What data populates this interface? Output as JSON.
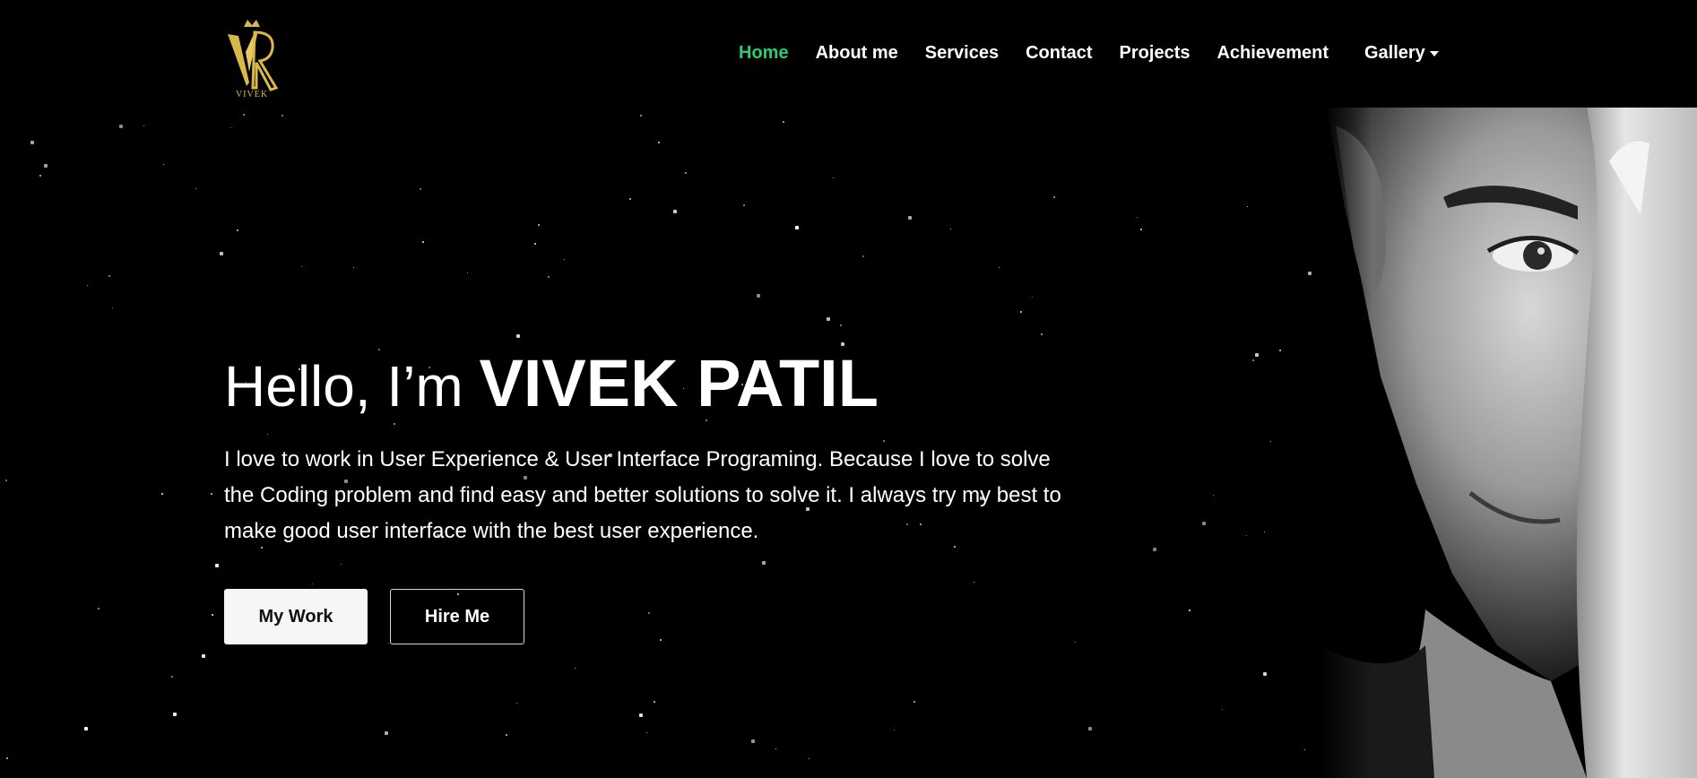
{
  "brand": {
    "logo_text": "VIVEK",
    "accent_color": "#d9b84a"
  },
  "nav": {
    "items": [
      {
        "label": "Home",
        "active": true
      },
      {
        "label": "About me"
      },
      {
        "label": "Services"
      },
      {
        "label": "Contact"
      },
      {
        "label": "Projects"
      },
      {
        "label": "Achievement"
      }
    ],
    "gallery_label": "Gallery",
    "gallery_icon": "caret-down-icon",
    "active_color": "#2ecc71"
  },
  "hero": {
    "greeting": "Hello, I’m",
    "name": "VIVEK PATIL",
    "description": "I love to work in User Experience & User Interface Programing. Because I love to solve the Coding problem and find easy and better solutions to solve it. I always try my best to make good user interface with the best user experience.",
    "primary_button": "My Work",
    "secondary_button": "Hire Me"
  },
  "background": {
    "color": "#000000",
    "decoration": "starfield"
  }
}
